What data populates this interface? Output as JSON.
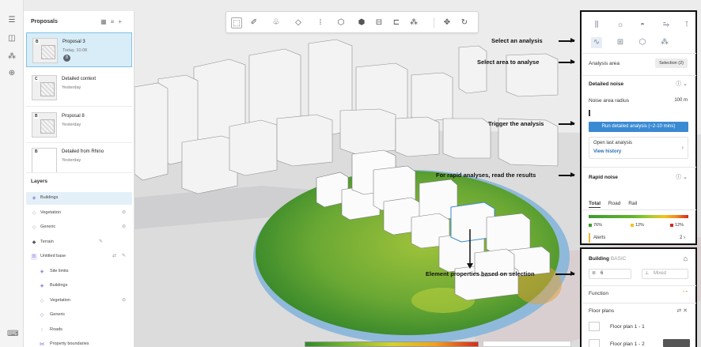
{
  "proposals": {
    "title": "Proposals",
    "items": [
      {
        "letter": "B",
        "name": "Proposal 3",
        "meta": "Today, 10:08",
        "badge": "8",
        "selected": true
      },
      {
        "letter": "C",
        "name": "Detailed context",
        "meta": "Yesterday"
      },
      {
        "letter": "B",
        "name": "Proposal 8",
        "meta": "Yesterday"
      },
      {
        "letter": "B",
        "name": "Detailed from Rhino",
        "meta": "Yesterday"
      }
    ]
  },
  "layers": {
    "title": "Layers",
    "items": [
      {
        "label": "Buildings",
        "icon": "cube-icon"
      },
      {
        "label": "Vegetation",
        "icon": "tree-icon"
      },
      {
        "label": "Generic",
        "icon": "shape-icon"
      },
      {
        "label": "Terrain",
        "icon": "terrain-icon"
      },
      {
        "label": "Untitled base",
        "icon": "base-icon"
      },
      {
        "label": "Site limits",
        "icon": "site-icon"
      },
      {
        "label": "Buildings",
        "icon": "cube-icon"
      },
      {
        "label": "Vegetation",
        "icon": "tree-icon"
      },
      {
        "label": "Generic",
        "icon": "shape-icon"
      },
      {
        "label": "Roads",
        "icon": "road-icon"
      },
      {
        "label": "Property boundaries",
        "icon": "boundary-icon"
      }
    ]
  },
  "analysis": {
    "area_label": "Analysis area",
    "area_value": "Selection (2)",
    "detailed_title": "Detailed noise",
    "radius_label": "Noise area radius",
    "radius_value": "100 m",
    "run_label": "Run detailed analysis (~2-10 mins)",
    "open_last": "Open last analysis",
    "view_history": "View history",
    "rapid_title": "Rapid noise",
    "tabs": [
      "Total",
      "Road",
      "Rail"
    ],
    "legend": [
      {
        "value": "76%",
        "color": "#3e9b2c"
      },
      {
        "value": "12%",
        "color": "#f2c31d"
      },
      {
        "value": "12%",
        "color": "#d9261c"
      }
    ],
    "alerts_label": "Alerts",
    "alerts_count": "2"
  },
  "building": {
    "title": "Building",
    "type": "BASIC",
    "floors": "6",
    "use": "Mixed",
    "function_label": "Function",
    "floor_plans_title": "Floor plans",
    "floor_plans": [
      "Floor plan 1 - 1",
      "Floor plan 1 - 2"
    ]
  },
  "annotations": [
    "Select an analysis",
    "Select area to analyse",
    "Trigger the analysis",
    "For rapid analyses, read the results",
    "Element properties based on selection"
  ],
  "colors": {
    "accent": "#3a8ad3",
    "selection": "#d8edf7",
    "noise_low": "#3e9b2c",
    "noise_high": "#d9261c"
  }
}
